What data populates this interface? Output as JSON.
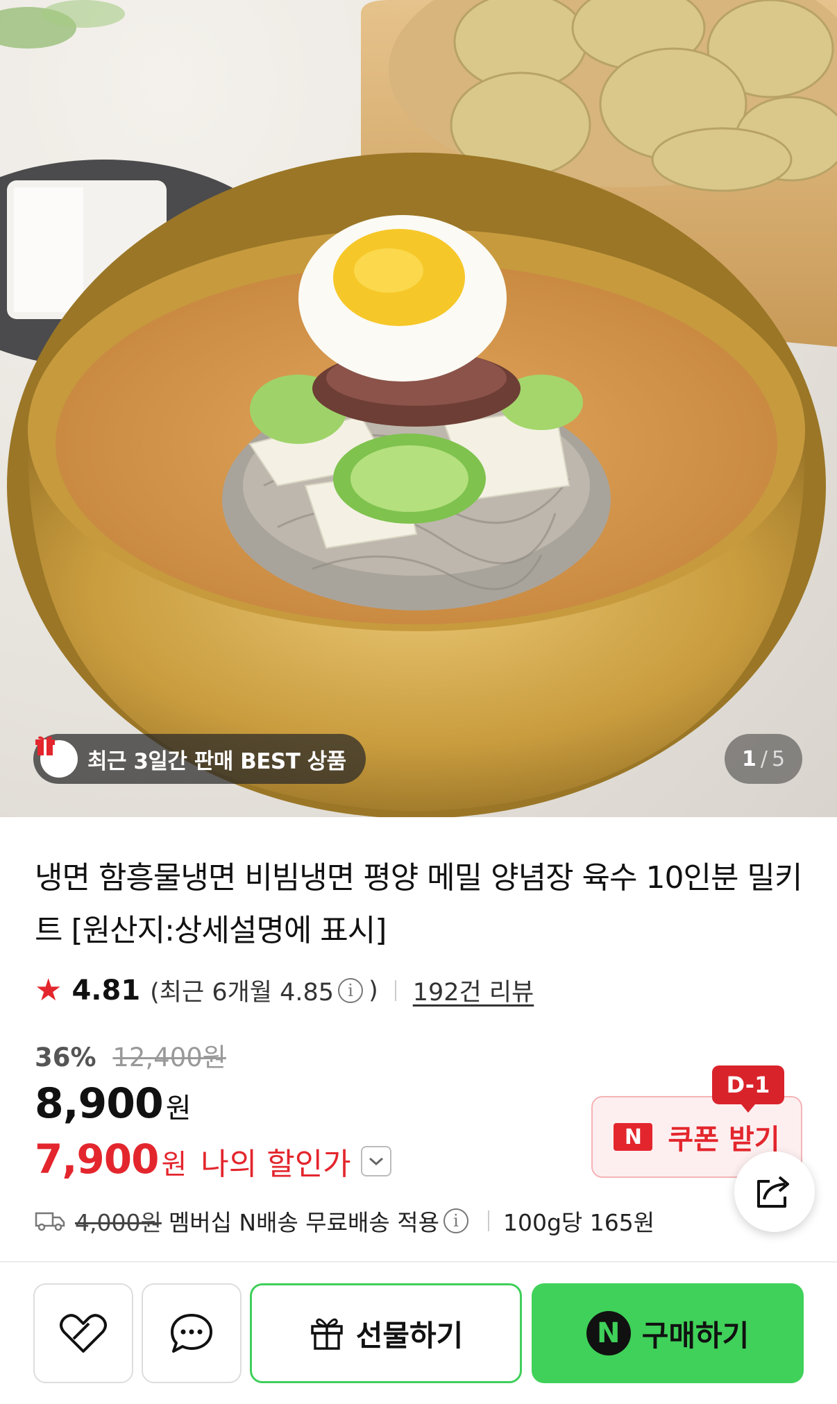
{
  "hero": {
    "badge_text": "최근 3일간 판매 BEST 상품",
    "pager_current": "1",
    "pager_sep": "/",
    "pager_total": "5"
  },
  "product": {
    "title": "냉면 함흥물냉면 비빔냉면 평양 메밀 양념장 육수 10인분 밀키트 [원산지:상세설명에 표시]",
    "rating": "4.81",
    "recent_rating_label": "(최근 6개월 4.85",
    "recent_rating_close": ")",
    "review_count": "192건 리뷰",
    "discount_percent": "36%",
    "original_price": "12,400원",
    "price": "8,900",
    "price_unit": "원",
    "my_price": "7,900",
    "my_price_unit": "원",
    "my_price_label": "나의 할인가"
  },
  "coupon": {
    "dday": "D-1",
    "n_mark": "N",
    "label": "쿠폰 받기"
  },
  "delivery": {
    "original_fee": "4,000원",
    "text": "멤버십 N배송 무료배송 적용",
    "unit_price": "100g당 165원"
  },
  "actions": {
    "gift_label": "선물하기",
    "buy_mark": "N",
    "buy_label": "구매하기"
  },
  "colors": {
    "accent_red": "#e3262d",
    "naver_green": "#3fd159"
  }
}
